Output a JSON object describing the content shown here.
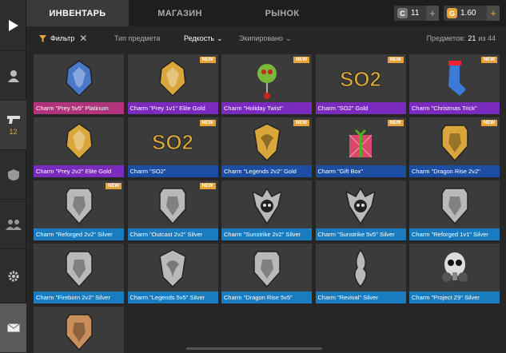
{
  "sidebar": {
    "weapons_count": "12"
  },
  "tabs": [
    {
      "label": "ИНВЕНТАРЬ"
    },
    {
      "label": "МАГАЗИН"
    },
    {
      "label": "РЫНОК"
    }
  ],
  "currency": {
    "crowns": "11",
    "gold": "1.60"
  },
  "filter": {
    "label": "Фильтр",
    "item_type": "Тип предмета",
    "rarity": "Редкость",
    "equipped": "Экипировано",
    "count_label": "Предметов:",
    "count_value": "21",
    "count_of": "из 44"
  },
  "new_badge": "NEW",
  "colors": {
    "platinum": "#b0337c",
    "elite_gold": "#7a2abc",
    "gold": "#1c4fa3",
    "silver": "#1a7cc0",
    "new": "#e5a33a"
  },
  "items": [
    {
      "name": "Charm \"Prey 5v5\" Platinum",
      "rarity": "platinum",
      "new": false,
      "icon": "wolf-emblem"
    },
    {
      "name": "Charm \"Prey 1v1\" Elite Gold",
      "rarity": "elite_gold",
      "new": true,
      "icon": "wolf-emblem"
    },
    {
      "name": "Charm \"Holiday Twist\"",
      "rarity": "elite_gold",
      "new": true,
      "icon": "holiday-ornament"
    },
    {
      "name": "Charm \"SO2\" Gold",
      "rarity": "elite_gold",
      "new": true,
      "icon": "so2-logo"
    },
    {
      "name": "Charm \"Christmas Trick\"",
      "rarity": "elite_gold",
      "new": true,
      "icon": "stocking"
    },
    {
      "name": "Charm \"Prey 2v2\" Elite Gold",
      "rarity": "elite_gold",
      "new": false,
      "icon": "wolf-emblem"
    },
    {
      "name": "Charm \"SO2\"",
      "rarity": "gold",
      "new": true,
      "icon": "so2-logo"
    },
    {
      "name": "Charm \"Legends 2v2\" Gold",
      "rarity": "gold",
      "new": true,
      "icon": "dragon-emblem"
    },
    {
      "name": "Charm \"Gift Box\"",
      "rarity": "gold",
      "new": true,
      "icon": "gift-box"
    },
    {
      "name": "Charm \"Dragon Rise 2v2\"",
      "rarity": "gold",
      "new": true,
      "icon": "shield-emblem"
    },
    {
      "name": "Charm \"Reforged 2v2\" Silver",
      "rarity": "silver",
      "new": true,
      "icon": "shield-emblem"
    },
    {
      "name": "Charm \"Outcast 2v2\" Silver",
      "rarity": "silver",
      "new": true,
      "icon": "shield-emblem"
    },
    {
      "name": "Charm \"Sunstrike 2v2\" Silver",
      "rarity": "silver",
      "new": false,
      "icon": "skull-emblem"
    },
    {
      "name": "Charm \"Sunstrike 5v5\" Silver",
      "rarity": "silver",
      "new": false,
      "icon": "skull-emblem"
    },
    {
      "name": "Charm \"Reforged 1v1\" Silver",
      "rarity": "silver",
      "new": false,
      "icon": "shield-emblem"
    },
    {
      "name": "Charm \"Fireborn 2v2\" Silver",
      "rarity": "silver",
      "new": false,
      "icon": "shield-emblem"
    },
    {
      "name": "Charm \"Legends 5v5\" Silver",
      "rarity": "silver",
      "new": false,
      "icon": "dragon-emblem"
    },
    {
      "name": "Charm \"Dragon Rise 5v5\"",
      "rarity": "silver",
      "new": false,
      "icon": "shield-emblem"
    },
    {
      "name": "Charm \"Revival\" Silver",
      "rarity": "silver",
      "new": false,
      "icon": "flame-emblem"
    },
    {
      "name": "Charm \"Project Z9\" Silver",
      "rarity": "silver",
      "new": false,
      "icon": "gasmask"
    },
    {
      "name": "",
      "rarity": "none",
      "new": false,
      "icon": "shield-emblem"
    }
  ]
}
